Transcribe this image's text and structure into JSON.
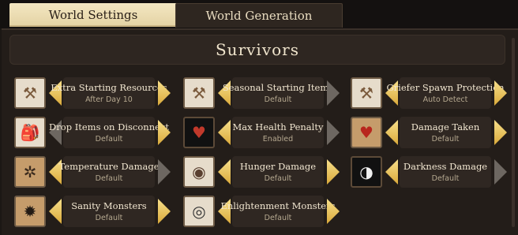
{
  "tabs": [
    {
      "label": "World Settings"
    },
    {
      "label": "World Generation"
    }
  ],
  "section": {
    "title": "Survivors"
  },
  "settings": [
    {
      "name": "Extra Starting Resources",
      "value": "After Day 10",
      "icon": "chest-icon",
      "glyph": "⚒",
      "left_arrow": "enabled",
      "right_arrow": "enabled"
    },
    {
      "name": "Seasonal Starting Items",
      "value": "Default",
      "icon": "chest-icon",
      "glyph": "⚒",
      "left_arrow": "enabled",
      "right_arrow": "disabled"
    },
    {
      "name": "Griefer Spawn Protection",
      "value": "Auto Detect",
      "icon": "chest-icon",
      "glyph": "⚒",
      "left_arrow": "enabled",
      "right_arrow": "enabled"
    },
    {
      "name": "Drop Items on Disconnect",
      "value": "Default",
      "icon": "backpack-icon",
      "glyph": "🎒",
      "left_arrow": "disabled",
      "right_arrow": "enabled"
    },
    {
      "name": "Max Health Penalty",
      "value": "Enabled",
      "icon": "health-icon",
      "glyph": "♥",
      "left_arrow": "enabled",
      "right_arrow": "disabled"
    },
    {
      "name": "Damage Taken",
      "value": "Default",
      "icon": "shield-heart-icon",
      "glyph": "♥",
      "left_arrow": "enabled",
      "right_arrow": "enabled"
    },
    {
      "name": "Temperature Damage",
      "value": "Default",
      "icon": "thermometer-icon",
      "glyph": "✲",
      "left_arrow": "enabled",
      "right_arrow": "disabled"
    },
    {
      "name": "Hunger Damage",
      "value": "Default",
      "icon": "stomach-icon",
      "glyph": "◉",
      "left_arrow": "enabled",
      "right_arrow": "enabled"
    },
    {
      "name": "Darkness Damage",
      "value": "Default",
      "icon": "darkness-icon",
      "glyph": "◑",
      "left_arrow": "enabled",
      "right_arrow": "disabled"
    },
    {
      "name": "Sanity Monsters",
      "value": "Default",
      "icon": "shadow-monster-icon",
      "glyph": "✹",
      "left_arrow": "enabled",
      "right_arrow": "enabled"
    },
    {
      "name": "Enlightenment Monsters",
      "value": "Default",
      "icon": "eye-icon",
      "glyph": "◎",
      "left_arrow": "enabled",
      "right_arrow": "enabled"
    }
  ]
}
